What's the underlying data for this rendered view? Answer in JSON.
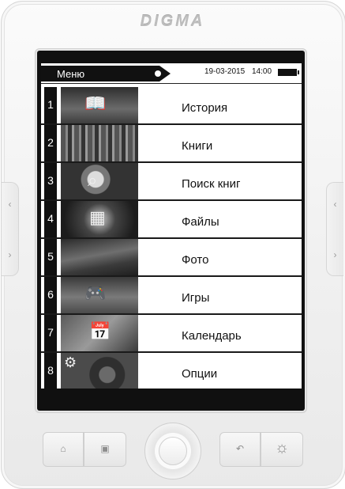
{
  "device": {
    "brand": "DIGMA"
  },
  "status_bar": {
    "title": "Меню",
    "date": "19-03-2015",
    "time": "14:00",
    "battery_level": 0.85
  },
  "menu": {
    "items": [
      {
        "number": "1",
        "label": "История",
        "icon": "open-book-icon"
      },
      {
        "number": "2",
        "label": "Книги",
        "icon": "bookshelf-icon"
      },
      {
        "number": "3",
        "label": "Поиск книг",
        "icon": "magnifier-icon"
      },
      {
        "number": "4",
        "label": "Файлы",
        "icon": "files-icon"
      },
      {
        "number": "5",
        "label": "Фото",
        "icon": "landscape-photo-icon"
      },
      {
        "number": "6",
        "label": "Игры",
        "icon": "gamepad-icon"
      },
      {
        "number": "7",
        "label": "Календарь",
        "icon": "calendar-icon"
      },
      {
        "number": "8",
        "label": "Опции",
        "icon": "gear-icon"
      }
    ]
  },
  "hardware_buttons": {
    "home": "home-icon",
    "menu": "menu-icon",
    "back": "back-arrow-icon",
    "light": "backlight-icon",
    "side_left_top": "chevron-left-icon",
    "side_left_bottom": "chevron-right-icon",
    "side_right_top": "chevron-left-icon",
    "side_right_bottom": "chevron-right-icon"
  }
}
